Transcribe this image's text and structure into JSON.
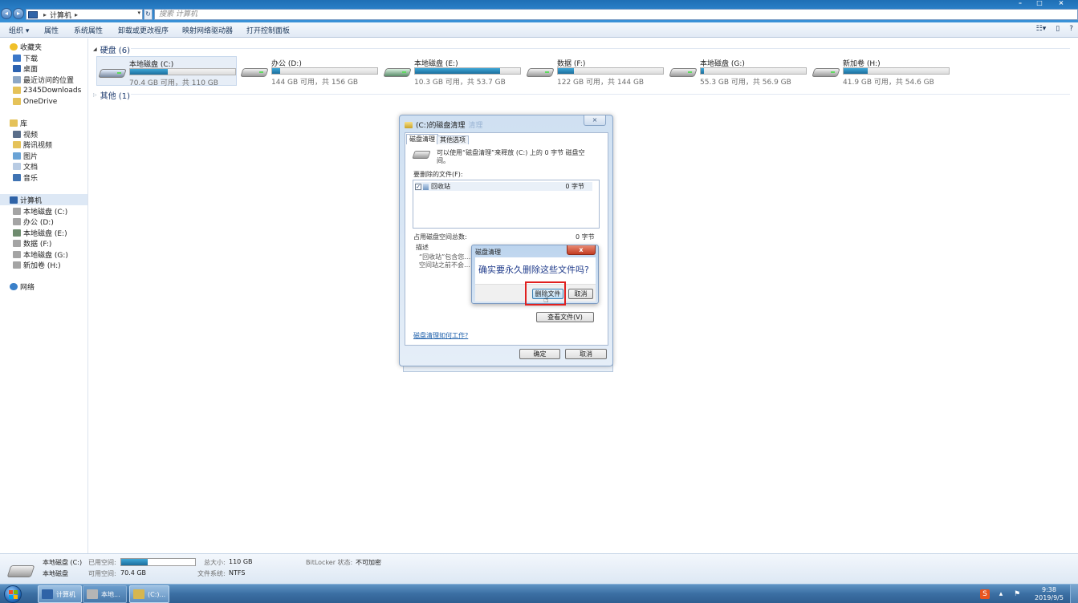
{
  "address": {
    "location": "计算机",
    "search_placeholder": "搜索 计算机"
  },
  "window_controls": {
    "minimize": "–",
    "maximize": "□",
    "close": "×"
  },
  "toolbar": {
    "organize": "组织 ▾",
    "properties": "属性",
    "system_properties": "系统属性",
    "uninstall": "卸载或更改程序",
    "map_drive": "映射网络驱动器",
    "control_panel": "打开控制面板"
  },
  "sidebar": {
    "favorites": "收藏夹",
    "downloads": "下载",
    "desktop": "桌面",
    "recent": "最近访问的位置",
    "downloads2345": "2345Downloads",
    "onedrive": "OneDrive",
    "libraries": "库",
    "videos": "视频",
    "tencent_video": "腾讯视频",
    "pictures": "图片",
    "documents": "文档",
    "music": "音乐",
    "computer": "计算机",
    "drives": [
      "本地磁盘 (C:)",
      "办公 (D:)",
      "本地磁盘 (E:)",
      "数据 (F:)",
      "本地磁盘 (G:)",
      "新加卷 (H:)"
    ],
    "network": "网络"
  },
  "content": {
    "hard_disks_header": "硬盘 (6)",
    "other_header": "其他 (1)",
    "drives": [
      {
        "name": "本地磁盘 (C:)",
        "info": "70.4 GB 可用，共 110 GB",
        "used_fraction": 0.36
      },
      {
        "name": "办公 (D:)",
        "info": "144 GB 可用，共 156 GB",
        "used_fraction": 0.08
      },
      {
        "name": "本地磁盘 (E:)",
        "info": "10.3 GB 可用，共 53.7 GB",
        "used_fraction": 0.81
      },
      {
        "name": "数据 (F:)",
        "info": "122 GB 可用，共 144 GB",
        "used_fraction": 0.15
      },
      {
        "name": "本地磁盘 (G:)",
        "info": "55.3 GB 可用，共 56.9 GB",
        "used_fraction": 0.03
      },
      {
        "name": "新加卷 (H:)",
        "info": "41.9 GB 可用，共 54.6 GB",
        "used_fraction": 0.23
      }
    ]
  },
  "cleanup_dialog": {
    "title": "(C:)的磁盘清理",
    "title_suffix": "清理",
    "close": "×",
    "tab_cleanup": "磁盘清理",
    "tab_more": "其他选项",
    "intro": "可以使用“磁盘清理”来释放 (C:) 上的 0 字节 磁盘空间。",
    "files_to_delete_label": "要删除的文件(F):",
    "file_name": "回收站",
    "file_size": "0 字节",
    "total_label": "占用磁盘空间总数:",
    "total_value": "0 字节",
    "description_label": "描述",
    "description_text": "“回收站”包含您… 空间站之前不会…",
    "view_files": "查看文件(V)",
    "how_link": "磁盘清理如何工作?",
    "ok": "确定",
    "cancel": "取消"
  },
  "confirm_dialog": {
    "title": "磁盘清理",
    "close": "x",
    "message": "确实要永久删除这些文件吗?",
    "delete_button": "删除文件",
    "cancel_button": "取消"
  },
  "details": {
    "drive_name": "本地磁盘 (C:)",
    "drive_type": "本地磁盘",
    "used_label": "已用空间:",
    "free_label": "可用空间:",
    "free_value": "70.4 GB",
    "used_fraction": 0.36,
    "total_label": "总大小:",
    "total_value": "110 GB",
    "fs_label": "文件系统:",
    "fs_value": "NTFS",
    "bitlocker_label": "BitLocker 状态:",
    "bitlocker_value": "不可加密"
  },
  "taskbar": {
    "items": [
      "计算机",
      "本地...",
      "(C:)..."
    ],
    "time": "9:38",
    "date": "2019/9/5",
    "ime": "S"
  },
  "colors": {
    "highlight_box": "#e0201f",
    "drive_fill": "#1c6d9c"
  }
}
